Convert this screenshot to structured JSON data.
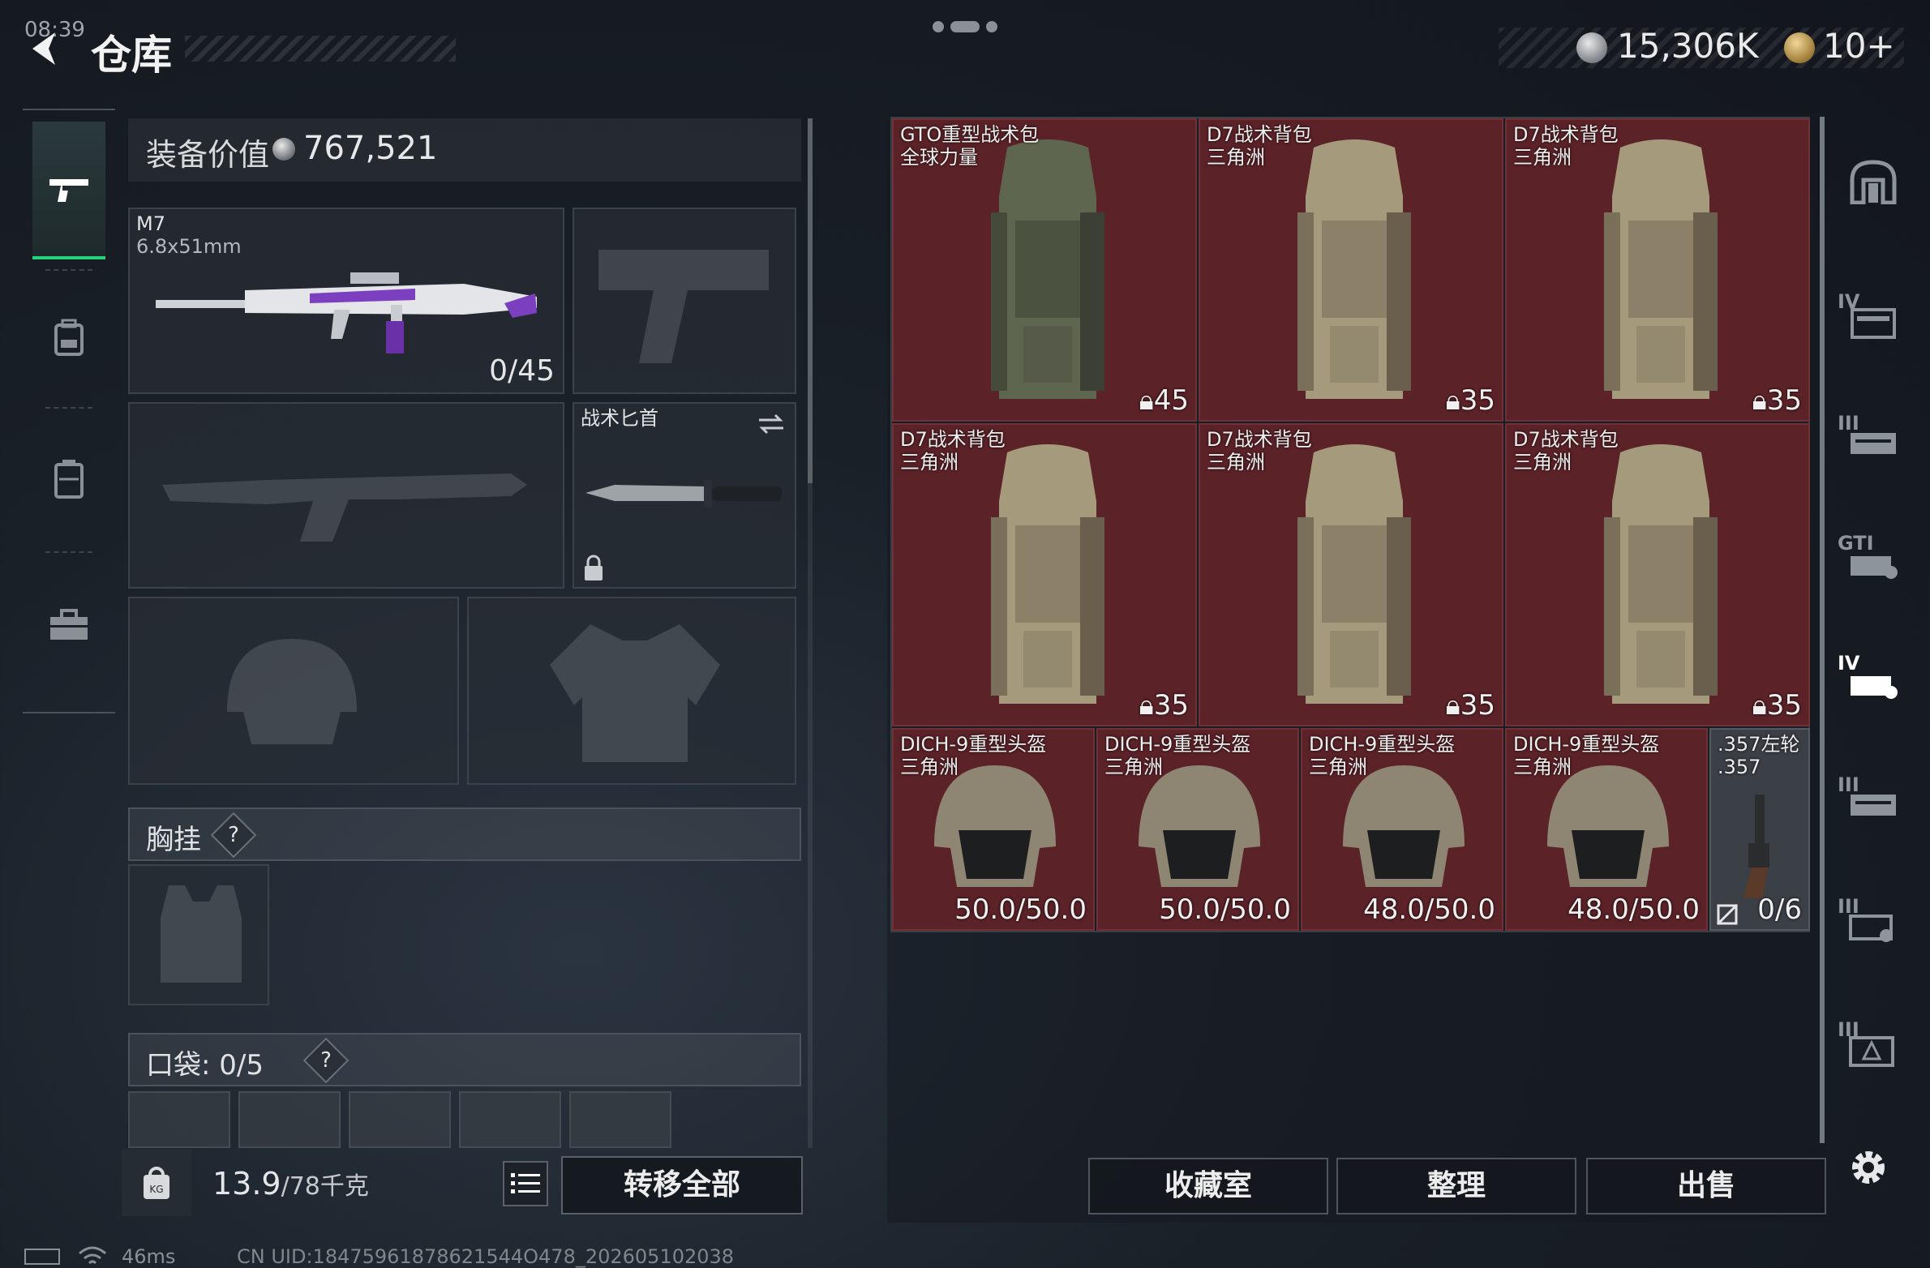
{
  "status": {
    "time": "08:39",
    "ping": "46ms",
    "uid": "CN UID:18475961878621544O478_202605102038"
  },
  "header": {
    "title": "仓库",
    "currency": {
      "coins": "15,306K",
      "tickets": "10+"
    }
  },
  "equipment": {
    "value_label": "装备价值",
    "value_amount": "767,521",
    "primary_weapon": {
      "name": "M7",
      "caliber": "6.8x51mm",
      "ammo": "0/45"
    },
    "melee": {
      "name": "战术匕首"
    },
    "chest_rig_label": "胸挂",
    "pocket_label": "口袋: 0/5",
    "help_glyph": "?"
  },
  "bottom_bar": {
    "weight": "13.9",
    "weight_capacity": "/78千克",
    "transfer_all": "转移全部"
  },
  "stash": {
    "items": [
      {
        "name": "GTO重型战术包",
        "sub": "全球力量",
        "capacity": "45",
        "kind": "backpack"
      },
      {
        "name": "D7战术背包",
        "sub": "三角洲",
        "capacity": "35",
        "kind": "backpack"
      },
      {
        "name": "D7战术背包",
        "sub": "三角洲",
        "capacity": "35",
        "kind": "backpack"
      },
      {
        "name": "D7战术背包",
        "sub": "三角洲",
        "capacity": "35",
        "kind": "backpack"
      },
      {
        "name": "D7战术背包",
        "sub": "三角洲",
        "capacity": "35",
        "kind": "backpack"
      },
      {
        "name": "D7战术背包",
        "sub": "三角洲",
        "capacity": "35",
        "kind": "backpack"
      },
      {
        "name": "DICH-9重型头盔",
        "sub": "三角洲",
        "durability": "50.0/50.0",
        "kind": "helmet"
      },
      {
        "name": "DICH-9重型头盔",
        "sub": "三角洲",
        "durability": "50.0/50.0",
        "kind": "helmet"
      },
      {
        "name": "DICH-9重型头盔",
        "sub": "三角洲",
        "durability": "48.0/50.0",
        "kind": "helmet"
      },
      {
        "name": "DICH-9重型头盔",
        "sub": "三角洲",
        "durability": "48.0/50.0",
        "kind": "helmet"
      },
      {
        "name": ".357左轮",
        "sub": ".357",
        "ammo": "0/6",
        "kind": "revolver"
      }
    ],
    "tier_labels": [
      "IV",
      "III",
      "GTI",
      "IV",
      "III",
      "III",
      "III"
    ],
    "buttons": {
      "collection": "收藏室",
      "organize": "整理",
      "sell": "出售"
    }
  },
  "colors": {
    "accent_green": "#24d27a",
    "item_red": "#5b2228"
  }
}
